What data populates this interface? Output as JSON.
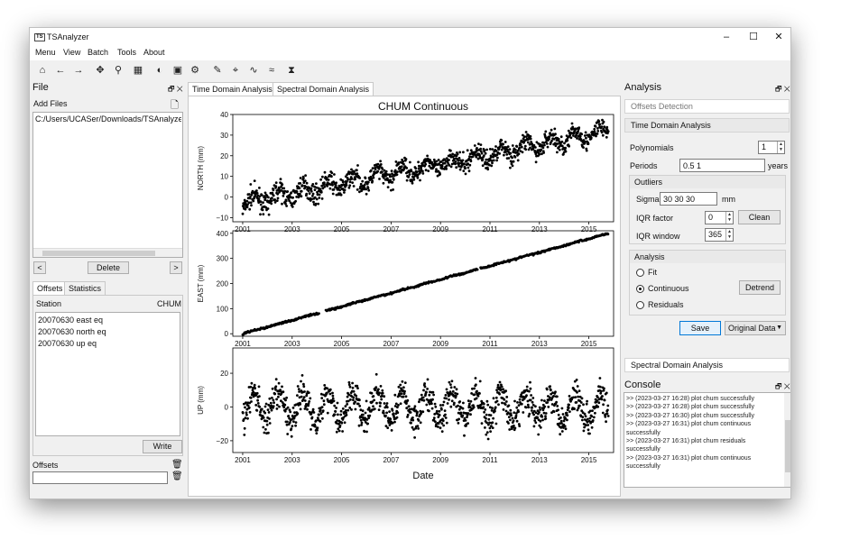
{
  "window": {
    "app_icon": "TS",
    "title": "TSAnalyzer",
    "controls": [
      "–",
      "☐",
      "✕"
    ]
  },
  "menubar": [
    "Menu",
    "View",
    "Batch",
    "Tools",
    "About"
  ],
  "toolbar_icons": [
    "home-icon",
    "back-arrow-icon",
    "forward-arrow-icon",
    "pan-icon",
    "zoom-icon",
    "grid-icon",
    "pie-icon",
    "image-icon",
    "settings-icon",
    "pen-icon",
    "fit-icon",
    "wave-icon",
    "wave2-icon",
    "marker-icon"
  ],
  "file_panel": {
    "title": "File",
    "add_files": "Add Files",
    "path": "C:/Users/UCASer/Downloads/TSAnalyzer-v",
    "nav_left": "<",
    "nav_right": ">",
    "delete": "Delete",
    "tabs": [
      "Offsets",
      "Statistics"
    ],
    "station_label": "Station",
    "station_value": "CHUM",
    "offsets": [
      "20070630 east eq",
      "20070630 north eq",
      "20070630 up eq"
    ],
    "write": "Write",
    "offsets_label": "Offsets"
  },
  "center": {
    "tabs": [
      "Time Domain Analysis",
      "Spectral Domain Analysis"
    ]
  },
  "chart_data": {
    "type": "scatter",
    "title": "CHUM Continuous",
    "xlabel": "Date",
    "x_ticks": [
      "2001",
      "2003",
      "2005",
      "2007",
      "2009",
      "2011",
      "2013",
      "2015"
    ],
    "xlim": [
      2000.6,
      2016.0
    ],
    "series": [
      {
        "name": "NORTH (mm)",
        "ylim": [
          -12,
          40
        ],
        "y_ticks": [
          "40",
          "30",
          "20",
          "10",
          "0",
          "−10"
        ],
        "trend": {
          "start": -3,
          "end": 32
        },
        "seasonal_amplitude": 3,
        "noise": 2.5
      },
      {
        "name": "EAST (mm)",
        "ylim": [
          -10,
          410
        ],
        "y_ticks": [
          "400",
          "300",
          "200",
          "100",
          "0"
        ],
        "trend": {
          "start": 0,
          "end": 400
        },
        "seasonal_amplitude": 1,
        "noise": 2
      },
      {
        "name": "UP (mm)",
        "ylim": [
          -27,
          35
        ],
        "y_ticks": [
          "20",
          "0",
          "−20"
        ],
        "trend": {
          "start": 0,
          "end": 0
        },
        "seasonal_amplitude": 8,
        "noise": 5
      }
    ],
    "data_span": [
      2001.0,
      2015.8
    ]
  },
  "analysis_panel": {
    "title": "Analysis",
    "offsets_detection": "Offsets Detection",
    "time_domain": "Time Domain Analysis",
    "polynomials_label": "Polynomials",
    "polynomials_value": "1",
    "periods_label": "Periods",
    "periods_value": "0.5 1",
    "periods_unit": "years",
    "outliers_label": "Outliers",
    "sigma_label": "Sigma",
    "sigma_value": "30 30 30",
    "sigma_unit": "mm",
    "iqr_factor_label": "IQR factor",
    "iqr_factor_value": "0",
    "clean": "Clean",
    "iqr_window_label": "IQR window",
    "iqr_window_value": "365",
    "analysis_label": "Analysis",
    "radio_fit": "Fit",
    "radio_continuous": "Continuous",
    "radio_residuals": "Residuals",
    "detrend": "Detrend",
    "save": "Save",
    "data_select": "Original Data",
    "spectral": "Spectral Domain Analysis"
  },
  "console": {
    "title": "Console",
    "lines": [
      ">> (2023-03-27 16:28) plot chum successfully",
      ">> (2023-03-27 16:28) plot chum successfully",
      ">> (2023-03-27 16:30) plot chum successfully",
      ">> (2023-03-27 16:31) plot chum continuous",
      "successfully",
      ">> (2023-03-27 16:31) plot chum residuals",
      "successfully",
      ">> (2023-03-27 16:31) plot chum continuous",
      "successfully"
    ]
  },
  "colors": {
    "accent": "#0078d7",
    "plot_points": "#000000",
    "bg": "#f0f0f0"
  }
}
